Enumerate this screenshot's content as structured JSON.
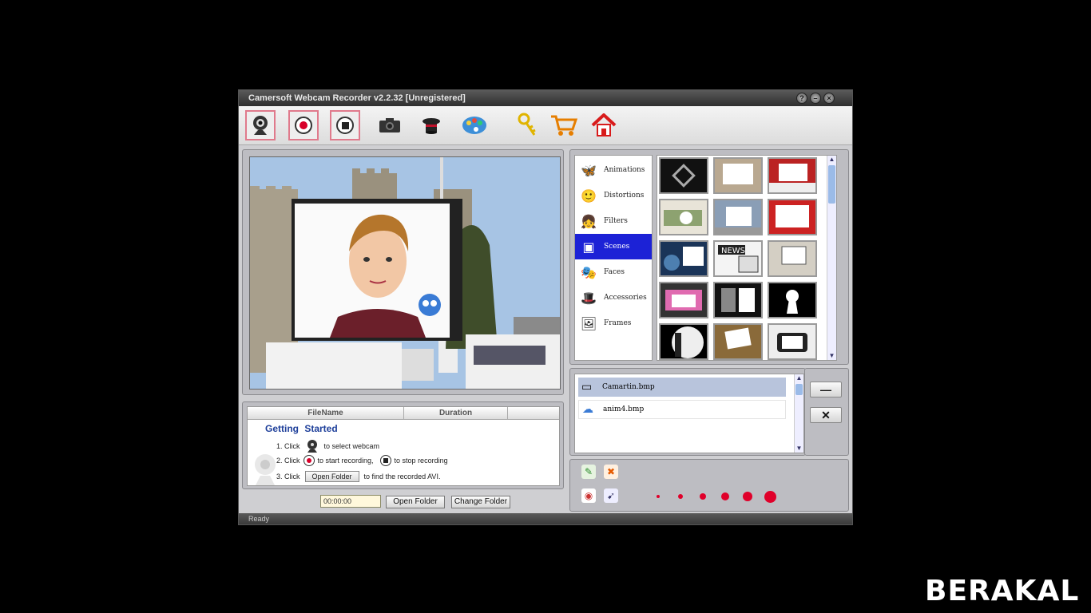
{
  "window": {
    "title": "Camersoft Webcam Recorder v2.2.32 [Unregistered]",
    "controls": [
      "?",
      "–",
      "×"
    ]
  },
  "toolbar": {
    "icons": [
      "webcam-icon",
      "record-icon",
      "stop-icon",
      "camera-icon",
      "magic-hat-icon",
      "palette-icon",
      "key-icon",
      "cart-icon",
      "home-icon"
    ]
  },
  "effects": {
    "categories": [
      {
        "label": "Animations",
        "icon": "butterfly-icon",
        "glyph": "🦋"
      },
      {
        "label": "Distortions",
        "icon": "face-icon",
        "glyph": "🙂"
      },
      {
        "label": "Filters",
        "icon": "girl-icon",
        "glyph": "👧"
      },
      {
        "label": "Scenes",
        "icon": "scene-icon",
        "glyph": "▣"
      },
      {
        "label": "Faces",
        "icon": "mask-icon",
        "glyph": "🎭"
      },
      {
        "label": "Accessories",
        "icon": "hat-icon",
        "glyph": "🎩"
      },
      {
        "label": "Frames",
        "icon": "frame-icon",
        "glyph": "🖼"
      }
    ],
    "selected_category": "Scenes"
  },
  "overlay_list": {
    "items": [
      {
        "label": "Camartin.bmp",
        "icon": "frame-icon"
      },
      {
        "label": "anim4.bmp",
        "icon": "cloud-icon"
      }
    ]
  },
  "side_buttons": {
    "remove": "—",
    "clear": "✕"
  },
  "file_table": {
    "headers": [
      "FileName",
      "Duration"
    ]
  },
  "getting_started": {
    "title": "Getting Started",
    "step1_prefix": "1. Click",
    "step1_suffix": "to select webcam",
    "step2_prefix": "2. Click",
    "step2_mid": "to start recording,",
    "step2_suffix": "to stop recording",
    "step3_prefix": "3. Click",
    "step3_button": "Open Folder",
    "step3_suffix": "to find the recorded AVI."
  },
  "bottom": {
    "timer": "00:00:00",
    "open_folder": "Open Folder",
    "change_folder": "Change Folder"
  },
  "status": "Ready",
  "brush_sizes": [
    2,
    3,
    4,
    5,
    6,
    7
  ],
  "colors": {
    "accent_red": "#e0002a",
    "selection_blue": "#1c22d6",
    "title_blue": "#1e3f9a"
  },
  "watermark": "BERAKAL"
}
